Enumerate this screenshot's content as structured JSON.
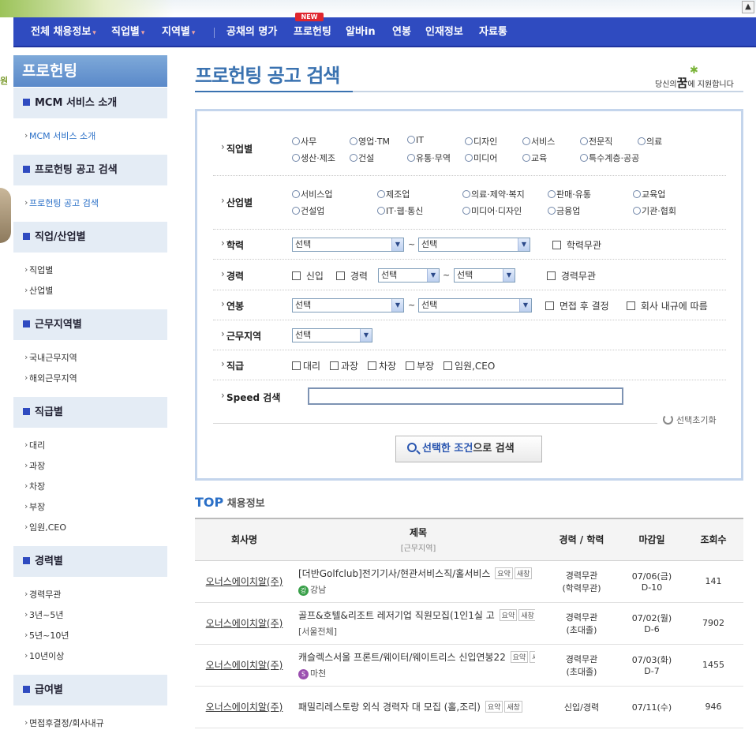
{
  "topbar": {
    "up_icon": "▲"
  },
  "gnb": {
    "items": [
      {
        "label": "전체 채용정보",
        "caret": true
      },
      {
        "label": "직업별",
        "caret": true
      },
      {
        "label": "지역별",
        "caret": true
      },
      {
        "label": "공채의 명가"
      },
      {
        "label": "프로헌팅",
        "new_badge": "NEW"
      },
      {
        "label": "알바in"
      },
      {
        "label": "연봉"
      },
      {
        "label": "인재정보"
      },
      {
        "label": "자료통"
      }
    ]
  },
  "leftedge": {
    "char": "원"
  },
  "sidebar": {
    "title": "프로헌팅",
    "groups": [
      {
        "head": "MCM 서비스 소개",
        "items": [
          "MCM 서비스 소개"
        ]
      },
      {
        "head": "프로헌팅 공고 검색",
        "items": [
          "프로헌팅 공고 검색"
        ]
      },
      {
        "head": "직업/산업별",
        "items": [
          "직업별",
          "산업별"
        ]
      },
      {
        "head": "근무지역별",
        "items": [
          "국내근무지역",
          "해외근무지역"
        ]
      },
      {
        "head": "직급별",
        "items": [
          "대리",
          "과장",
          "차장",
          "부장",
          "임원,CEO"
        ]
      },
      {
        "head": "경력별",
        "items": [
          "경력무관",
          "3년~5년",
          "5년~10년",
          "10년이상"
        ]
      },
      {
        "head": "급여별",
        "items": [
          "면접후결정/회사내규"
        ]
      }
    ]
  },
  "main": {
    "title": "프로헌팅 공고 검색",
    "slogan": {
      "pre": "당신의",
      "em": "꿈",
      "post": "에 지원합니다"
    }
  },
  "search": {
    "job_label": "직업별",
    "job_options": [
      "사무",
      "영업·TM",
      "IT",
      "디자인",
      "서비스",
      "전문직",
      "의료",
      "생산·제조",
      "건설",
      "유통·무역",
      "미디어",
      "교육",
      "특수계층·공공"
    ],
    "industry_label": "산업별",
    "industry_options": [
      "서비스업",
      "제조업",
      "의료·제약·복지",
      "판매·유통",
      "교육업",
      "건설업",
      "IT·웹·통신",
      "미디어·디자인",
      "금융업",
      "기관·협회"
    ],
    "edu_label": "학력",
    "edu_from": "선택",
    "edu_to": "선택",
    "edu_any": "학력무관",
    "career_label": "경력",
    "career_new": "신입",
    "career_exp": "경력",
    "career_from": "선택",
    "career_to": "선택",
    "career_any": "경력무관",
    "salary_label": "연봉",
    "salary_from": "선택",
    "salary_to": "선택",
    "salary_interview": "면접 후 결정",
    "salary_company": "회사 내규에 따름",
    "region_label": "근무지역",
    "region_value": "선택",
    "rank_label": "직급",
    "rank_options": [
      "대리",
      "과장",
      "차장",
      "부장",
      "임원,CEO"
    ],
    "speed_label": "Speed 검색",
    "speed_value": "",
    "tilde": "~",
    "reset": "선택초기화",
    "button": {
      "hl1": "선택한 조건",
      "rest": "으로 검색"
    }
  },
  "top_jobs": {
    "title_em": "TOP",
    "title_rest": " 채용정보",
    "headers": {
      "company": "회사명",
      "title": "제목",
      "title_sub": "[근무지역]",
      "career": "경력 / 학력",
      "deadline": "마감일",
      "views": "조회수"
    },
    "rows": [
      {
        "company": "오너스에이치알(주)",
        "title": "[더반Golfclub]전기기사/현관서비스직/홀서비스",
        "tag1": "요약",
        "tag2": "새창",
        "loc_badge": "강",
        "loc_color": "#3aa04a",
        "location": "강남",
        "career": "경력무관",
        "edu": "(학력무관)",
        "date": "07/06(금)",
        "dday": "D-10",
        "views": "141"
      },
      {
        "company": "오너스에이치알(주)",
        "title": "골프&호텔&리조트 레저기업 직원모집(1인1실 고",
        "tag1": "요약",
        "tag2": "새창",
        "loc_badge": "",
        "loc_color": "",
        "location": "[서울전체]",
        "career": "경력무관",
        "edu": "(초대졸)",
        "date": "07/02(월)",
        "dday": "D-6",
        "views": "7902"
      },
      {
        "company": "오너스에이치알(주)",
        "title": "캐슬렉스서울 프론트/웨이터/웨이트리스 신입연봉22",
        "tag1": "요약",
        "tag2": "새창",
        "loc_badge": "S",
        "loc_color": "#9b4fb0",
        "location": "마천",
        "career": "경력무관",
        "edu": "(초대졸)",
        "date": "07/03(화)",
        "dday": "D-7",
        "views": "1455"
      },
      {
        "company": "오너스에이치알(주)",
        "title": "패밀리레스토랑 외식 경력자 대 모집 (홀,조리)",
        "tag1": "요약",
        "tag2": "새창",
        "loc_badge": "",
        "loc_color": "",
        "location": "",
        "career": "신입/경력",
        "edu": "",
        "date": "07/11(수)",
        "dday": "",
        "views": "946"
      }
    ]
  }
}
